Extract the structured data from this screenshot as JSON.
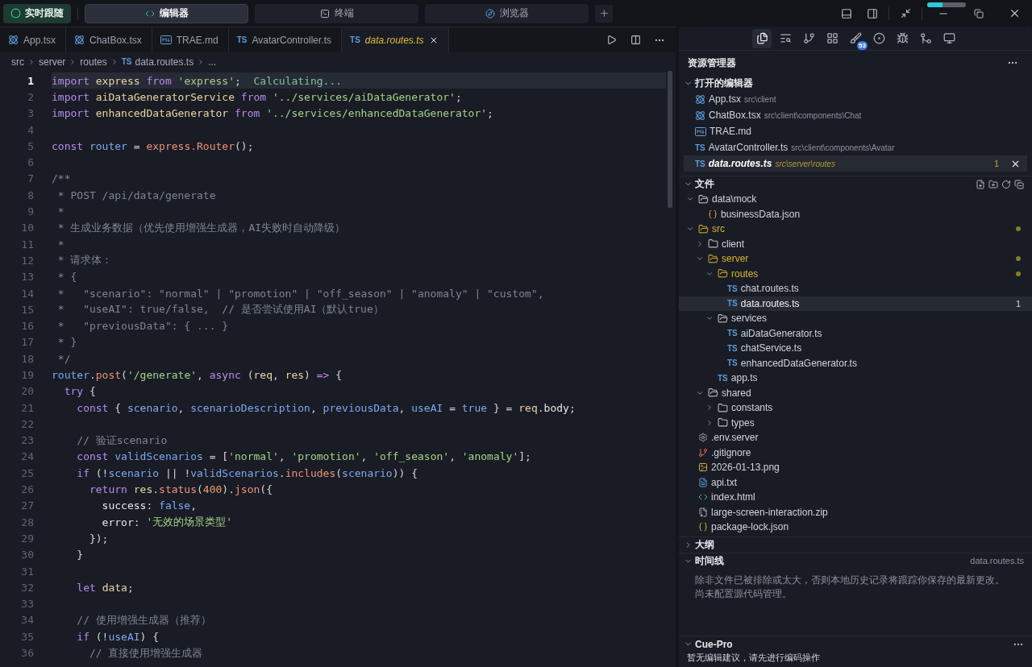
{
  "top_bar": {
    "follow_button": {
      "label": "实时跟随"
    },
    "modes": [
      {
        "label": "编辑器",
        "kind": "editor",
        "selected": true
      },
      {
        "label": "终端",
        "kind": "terminal",
        "selected": false
      },
      {
        "label": "浏览器",
        "kind": "browser",
        "selected": false
      }
    ],
    "progress": {
      "level": 0.4
    }
  },
  "editor": {
    "tabs": [
      {
        "name": "App.tsx",
        "kind": "react",
        "selected": false,
        "warning": false
      },
      {
        "name": "ChatBox.tsx",
        "kind": "react",
        "selected": false,
        "warning": false
      },
      {
        "name": "TRAE.md",
        "kind": "md",
        "selected": false,
        "warning": false
      },
      {
        "name": "AvatarController.ts",
        "kind": "ts",
        "tag": "TS",
        "selected": false,
        "warning": false
      },
      {
        "name": "data.routes.ts",
        "kind": "ts",
        "tag": "TS",
        "selected": true,
        "warning": true
      }
    ],
    "breadcrumb": [
      {
        "label": "src"
      },
      {
        "label": "server"
      },
      {
        "label": "routes"
      },
      {
        "label": "data.routes.ts",
        "tag": "TS"
      },
      {
        "label": "..."
      }
    ],
    "lines": [
      {
        "number": "1",
        "current": true,
        "segments": [
          {
            "kind": "kw",
            "text": "import "
          },
          {
            "kind": "id",
            "text": "express "
          },
          {
            "kind": "kw",
            "text": "from "
          },
          {
            "kind": "str",
            "text": "'express'"
          },
          {
            "kind": "punc",
            "text": ";"
          },
          {
            "kind": "hint",
            "text": "  Calculating..."
          }
        ]
      },
      {
        "number": "2",
        "current": false,
        "segments": [
          {
            "kind": "kw",
            "text": "import "
          },
          {
            "kind": "id",
            "text": "aiDataGeneratorService "
          },
          {
            "kind": "kw",
            "text": "from "
          },
          {
            "kind": "str",
            "text": "'../services/aiDataGenerator'"
          },
          {
            "kind": "punc",
            "text": ";"
          }
        ]
      },
      {
        "number": "3",
        "current": false,
        "segments": [
          {
            "kind": "kw",
            "text": "import "
          },
          {
            "kind": "id",
            "text": "enhancedDataGenerator "
          },
          {
            "kind": "kw",
            "text": "from "
          },
          {
            "kind": "str",
            "text": "'../services/enhancedDataGenerator'"
          },
          {
            "kind": "punc",
            "text": ";"
          }
        ]
      },
      {
        "number": "4",
        "current": false
      },
      {
        "number": "5",
        "current": false,
        "segments": [
          {
            "kind": "kw",
            "text": "const "
          },
          {
            "kind": "var",
            "text": "router"
          },
          {
            "kind": "punc",
            "text": " = "
          },
          {
            "kind": "fn",
            "text": "express.Router"
          },
          {
            "kind": "punc",
            "text": "();"
          }
        ]
      },
      {
        "number": "6",
        "current": false
      },
      {
        "number": "7",
        "current": false,
        "segments": [
          {
            "kind": "cmt",
            "text": "/**"
          }
        ]
      },
      {
        "number": "8",
        "current": false,
        "segments": [
          {
            "kind": "cmt",
            "text": " * POST /api/data/generate"
          }
        ]
      },
      {
        "number": "9",
        "current": false,
        "segments": [
          {
            "kind": "cmt",
            "text": " *"
          }
        ]
      },
      {
        "number": "10",
        "current": false,
        "segments": [
          {
            "kind": "cmt",
            "text": " * 生成业务数据（优先使用增强生成器，AI失败时自动降级）"
          }
        ]
      },
      {
        "number": "11",
        "current": false,
        "segments": [
          {
            "kind": "cmt",
            "text": " *"
          }
        ]
      },
      {
        "number": "12",
        "current": false,
        "segments": [
          {
            "kind": "cmt",
            "text": " * 请求体："
          }
        ]
      },
      {
        "number": "13",
        "current": false,
        "segments": [
          {
            "kind": "cmt",
            "text": " * {"
          }
        ]
      },
      {
        "number": "14",
        "current": false,
        "segments": [
          {
            "kind": "cmt",
            "text": " *   \"scenario\": \"normal\" | \"promotion\" | \"off_season\" | \"anomaly\" | \"custom\","
          }
        ]
      },
      {
        "number": "15",
        "current": false,
        "segments": [
          {
            "kind": "cmt",
            "text": " *   \"useAI\": true/false,  // 是否尝试使用AI（默认true）"
          }
        ]
      },
      {
        "number": "16",
        "current": false,
        "segments": [
          {
            "kind": "cmt",
            "text": " *   \"previousData\": { ... }"
          }
        ]
      },
      {
        "number": "17",
        "current": false,
        "segments": [
          {
            "kind": "cmt",
            "text": " * }"
          }
        ]
      },
      {
        "number": "18",
        "current": false,
        "segments": [
          {
            "kind": "cmt",
            "text": " */"
          }
        ]
      },
      {
        "number": "19",
        "current": false,
        "segments": [
          {
            "kind": "var",
            "text": "router"
          },
          {
            "kind": "punc",
            "text": "."
          },
          {
            "kind": "fn",
            "text": "post"
          },
          {
            "kind": "punc",
            "text": "("
          },
          {
            "kind": "str",
            "text": "'/generate'"
          },
          {
            "kind": "punc",
            "text": ", "
          },
          {
            "kind": "kw",
            "text": "async "
          },
          {
            "kind": "punc",
            "text": "("
          },
          {
            "kind": "id",
            "text": "req"
          },
          {
            "kind": "punc",
            "text": ", "
          },
          {
            "kind": "id",
            "text": "res"
          },
          {
            "kind": "punc",
            "text": ") "
          },
          {
            "kind": "kw",
            "text": "=> "
          },
          {
            "kind": "punc",
            "text": "{"
          }
        ]
      },
      {
        "number": "20",
        "current": false,
        "segments": [
          {
            "kind": "kw",
            "text": "  try "
          },
          {
            "kind": "punc",
            "text": "{"
          }
        ]
      },
      {
        "number": "21",
        "current": false,
        "segments": [
          {
            "kind": "kw",
            "text": "    const "
          },
          {
            "kind": "punc",
            "text": "{ "
          },
          {
            "kind": "var",
            "text": "scenario"
          },
          {
            "kind": "punc",
            "text": ", "
          },
          {
            "kind": "var",
            "text": "scenarioDescription"
          },
          {
            "kind": "punc",
            "text": ", "
          },
          {
            "kind": "var",
            "text": "previousData"
          },
          {
            "kind": "punc",
            "text": ", "
          },
          {
            "kind": "var",
            "text": "useAI"
          },
          {
            "kind": "punc",
            "text": " = "
          },
          {
            "kind": "bool",
            "text": "true"
          },
          {
            "kind": "punc",
            "text": " } = "
          },
          {
            "kind": "id",
            "text": "req"
          },
          {
            "kind": "punc",
            "text": "."
          },
          {
            "kind": "prop",
            "text": "body"
          },
          {
            "kind": "punc",
            "text": ";"
          }
        ]
      },
      {
        "number": "22",
        "current": false
      },
      {
        "number": "23",
        "current": false,
        "segments": [
          {
            "kind": "cmt",
            "text": "    // 验证scenario"
          }
        ]
      },
      {
        "number": "24",
        "current": false,
        "segments": [
          {
            "kind": "kw",
            "text": "    const "
          },
          {
            "kind": "var",
            "text": "validScenarios"
          },
          {
            "kind": "punc",
            "text": " = ["
          },
          {
            "kind": "str",
            "text": "'normal'"
          },
          {
            "kind": "punc",
            "text": ", "
          },
          {
            "kind": "str",
            "text": "'promotion'"
          },
          {
            "kind": "punc",
            "text": ", "
          },
          {
            "kind": "str",
            "text": "'off_season'"
          },
          {
            "kind": "punc",
            "text": ", "
          },
          {
            "kind": "str",
            "text": "'anomaly'"
          },
          {
            "kind": "punc",
            "text": "];"
          }
        ]
      },
      {
        "number": "25",
        "current": false,
        "segments": [
          {
            "kind": "kw",
            "text": "    if "
          },
          {
            "kind": "punc",
            "text": "(!"
          },
          {
            "kind": "var",
            "text": "scenario"
          },
          {
            "kind": "punc",
            "text": " || !"
          },
          {
            "kind": "var",
            "text": "validScenarios"
          },
          {
            "kind": "punc",
            "text": "."
          },
          {
            "kind": "fn",
            "text": "includes"
          },
          {
            "kind": "punc",
            "text": "("
          },
          {
            "kind": "var",
            "text": "scenario"
          },
          {
            "kind": "punc",
            "text": ")) {"
          }
        ]
      },
      {
        "number": "26",
        "current": false,
        "segments": [
          {
            "kind": "kw",
            "text": "      return "
          },
          {
            "kind": "id",
            "text": "res"
          },
          {
            "kind": "punc",
            "text": "."
          },
          {
            "kind": "fn",
            "text": "status"
          },
          {
            "kind": "punc",
            "text": "("
          },
          {
            "kind": "num",
            "text": "400"
          },
          {
            "kind": "punc",
            "text": ")."
          },
          {
            "kind": "fn",
            "text": "json"
          },
          {
            "kind": "punc",
            "text": "({"
          }
        ]
      },
      {
        "number": "27",
        "current": false,
        "segments": [
          {
            "kind": "prop",
            "text": "        success"
          },
          {
            "kind": "punc",
            "text": ": "
          },
          {
            "kind": "bool",
            "text": "false"
          },
          {
            "kind": "punc",
            "text": ","
          }
        ]
      },
      {
        "number": "28",
        "current": false,
        "segments": [
          {
            "kind": "prop",
            "text": "        error"
          },
          {
            "kind": "punc",
            "text": ": "
          },
          {
            "kind": "str",
            "text": "'无效的场景类型'"
          }
        ]
      },
      {
        "number": "29",
        "current": false,
        "segments": [
          {
            "kind": "punc",
            "text": "      });"
          }
        ]
      },
      {
        "number": "30",
        "current": false,
        "segments": [
          {
            "kind": "punc",
            "text": "    }"
          }
        ]
      },
      {
        "number": "31",
        "current": false
      },
      {
        "number": "32",
        "current": false,
        "segments": [
          {
            "kind": "kw",
            "text": "    let "
          },
          {
            "kind": "id",
            "text": "data"
          },
          {
            "kind": "punc",
            "text": ";"
          }
        ]
      },
      {
        "number": "33",
        "current": false
      },
      {
        "number": "34",
        "current": false,
        "segments": [
          {
            "kind": "cmt",
            "text": "    // 使用增强生成器（推荐）"
          }
        ]
      },
      {
        "number": "35",
        "current": false,
        "segments": [
          {
            "kind": "kw",
            "text": "    if "
          },
          {
            "kind": "punc",
            "text": "(!"
          },
          {
            "kind": "var",
            "text": "useAI"
          },
          {
            "kind": "punc",
            "text": ") {"
          }
        ]
      },
      {
        "number": "36",
        "current": false,
        "segments": [
          {
            "kind": "cmt",
            "text": "      // 直接使用增强生成器"
          }
        ]
      }
    ]
  },
  "activity_bar": [
    {
      "kind": "files",
      "selected": true
    },
    {
      "kind": "search",
      "selected": false
    },
    {
      "kind": "source-control",
      "selected": false
    },
    {
      "kind": "extensions",
      "selected": false
    },
    {
      "kind": "brush",
      "selected": false,
      "badge": "53"
    },
    {
      "kind": "ring",
      "selected": false
    },
    {
      "kind": "debug",
      "selected": false
    },
    {
      "kind": "git-graph",
      "selected": false
    },
    {
      "kind": "remote",
      "selected": false
    }
  ],
  "explorer": {
    "title": "资源管理器",
    "open_editors": {
      "title": "打开的编辑器",
      "expanded": true,
      "items": [
        {
          "name": "App.tsx",
          "path": "src\\client",
          "kind": "react",
          "selected": false,
          "warning": false
        },
        {
          "name": "ChatBox.tsx",
          "path": "src\\client\\components\\Chat",
          "kind": "react",
          "selected": false,
          "warning": false
        },
        {
          "name": "TRAE.md",
          "kind": "md",
          "selected": false,
          "warning": false
        },
        {
          "name": "AvatarController.ts",
          "path": "src\\client\\components\\Avatar",
          "kind": "ts",
          "tag": "TS",
          "selected": false,
          "warning": false
        },
        {
          "name": "data.routes.ts",
          "path": "src\\server\\routes",
          "kind": "ts",
          "tag": "TS",
          "selected": true,
          "warning": true,
          "badge": "1"
        }
      ]
    },
    "files": {
      "title": "文件",
      "expanded": true,
      "items": [
        {
          "name": "data\\mock",
          "kind": "folder",
          "expanded": true,
          "modified": false,
          "selected": false,
          "children": [
            {
              "name": "businessData.json",
              "kind": "json",
              "modified": false,
              "selected": false
            }
          ]
        },
        {
          "name": "src",
          "kind": "folder",
          "expanded": true,
          "modified": true,
          "selected": false,
          "children": [
            {
              "name": "client",
              "kind": "folder",
              "expanded": false,
              "modified": false,
              "selected": false
            },
            {
              "name": "server",
              "kind": "folder",
              "expanded": true,
              "modified": true,
              "selected": false,
              "children": [
                {
                  "name": "routes",
                  "kind": "folder",
                  "expanded": true,
                  "modified": true,
                  "selected": false,
                  "children": [
                    {
                      "name": "chat.routes.ts",
                      "kind": "ts",
                      "tag": "TS",
                      "modified": false,
                      "selected": false
                    },
                    {
                      "name": "data.routes.ts",
                      "kind": "ts",
                      "tag": "TS",
                      "modified": false,
                      "selected": true,
                      "badge": "1"
                    }
                  ]
                },
                {
                  "name": "services",
                  "kind": "folder",
                  "expanded": true,
                  "modified": false,
                  "selected": false,
                  "children": [
                    {
                      "name": "aiDataGenerator.ts",
                      "kind": "ts",
                      "tag": "TS",
                      "modified": false,
                      "selected": false
                    },
                    {
                      "name": "chatService.ts",
                      "kind": "ts",
                      "tag": "TS",
                      "modified": false,
                      "selected": false
                    },
                    {
                      "name": "enhancedDataGenerator.ts",
                      "kind": "ts",
                      "tag": "TS",
                      "modified": false,
                      "selected": false
                    }
                  ]
                },
                {
                  "name": "app.ts",
                  "kind": "ts",
                  "tag": "TS",
                  "modified": false,
                  "selected": false
                }
              ]
            },
            {
              "name": "shared",
              "kind": "folder",
              "expanded": true,
              "modified": false,
              "selected": false,
              "children": [
                {
                  "name": "constants",
                  "kind": "folder",
                  "expanded": false,
                  "modified": false,
                  "selected": false
                },
                {
                  "name": "types",
                  "kind": "folder",
                  "expanded": false,
                  "modified": false,
                  "selected": false
                }
              ]
            }
          ]
        },
        {
          "name": ".env.server",
          "kind": "gear",
          "modified": false,
          "selected": false
        },
        {
          "name": ".gitignore",
          "kind": "git",
          "modified": false,
          "selected": false
        },
        {
          "name": "2026-01-13.png",
          "kind": "image",
          "modified": false,
          "selected": false
        },
        {
          "name": "api.txt",
          "kind": "text",
          "modified": false,
          "selected": false
        },
        {
          "name": "index.html",
          "kind": "html",
          "modified": false,
          "selected": false
        },
        {
          "name": "large-screen-interaction.zip",
          "kind": "zip",
          "modified": false,
          "selected": false
        },
        {
          "name": "package-lock.json",
          "kind": "json",
          "modified": false,
          "selected": false
        }
      ]
    },
    "outline": {
      "title": "大纲",
      "expanded": false
    },
    "timeline": {
      "title": "时间线",
      "expanded": true,
      "file": "data.routes.ts",
      "message": "除非文件已被排除或太大，否则本地历史记录将跟踪你保存的最新更改。尚未配置源代码管理。"
    },
    "cue_pro": {
      "title": "Cue-Pro",
      "expanded": true,
      "message": "暂无编辑建议，请先进行编码操作"
    }
  }
}
